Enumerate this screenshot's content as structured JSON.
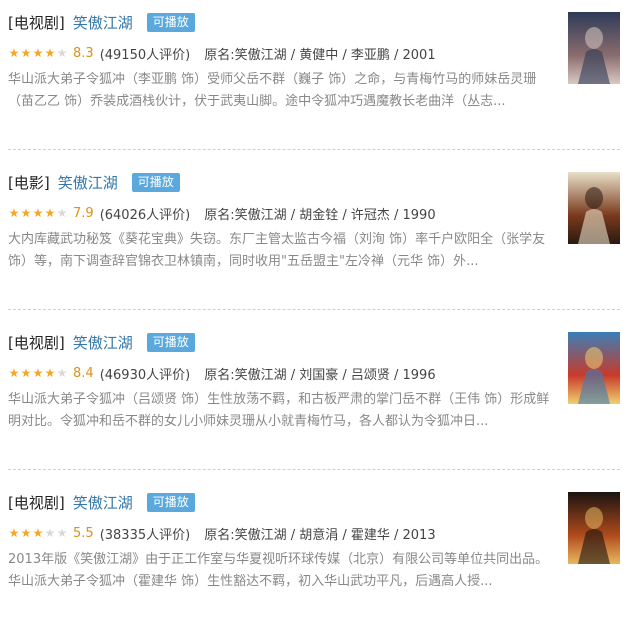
{
  "results": [
    {
      "category": "[电视剧]",
      "title": "笑傲江湖",
      "badge": "可播放",
      "rating_stars": 4,
      "score": "8.3",
      "votes": "(49150人评价)",
      "original": "原名:笑傲江湖 / 黄健中 / 李亚鹏 / 2001",
      "description": "华山派大弟子令狐冲（李亚鹏 饰）受师父岳不群（巍子 饰）之命，与青梅竹马的师妹岳灵珊（苗乙乙 饰）乔装成酒栈伙计，伏于武夷山脚。途中令狐冲巧遇魔教长老曲洋（丛志...",
      "poster_colors": [
        "#2d3b57",
        "#8a6c6e",
        "#d9c8c3"
      ]
    },
    {
      "category": "[电影]",
      "title": "笑傲江湖",
      "badge": "可播放",
      "rating_stars": 4,
      "score": "7.9",
      "votes": "(64026人评价)",
      "original": "原名:笑傲江湖 / 胡金铨 / 许冠杰 / 1990",
      "description": "大内库藏武功秘笈《葵花宝典》失窃。东厂主管太监古今福（刘洵 饰）率千户欧阳全（张学友 饰）等，南下调查辞官锦衣卫林镇南，同时收用\"五岳盟主\"左冷禅（元华 饰）外...",
      "poster_colors": [
        "#e8e0c8",
        "#7a3a1e",
        "#2a1a10"
      ]
    },
    {
      "category": "[电视剧]",
      "title": "笑傲江湖",
      "badge": "可播放",
      "rating_stars": 4,
      "score": "8.4",
      "votes": "(46930人评价)",
      "original": "原名:笑傲江湖 / 刘国豪 / 吕颂贤 / 1996",
      "description": "华山派大弟子令狐冲（吕颂贤 饰）生性放荡不羁，和古板严肃的掌门岳不群（王伟 饰）形成鲜明对比。令狐冲和岳不群的女儿小师妹灵珊从小就青梅竹马，各人都认为令狐冲日...",
      "poster_colors": [
        "#3a7fb8",
        "#c83a2a",
        "#f0d070"
      ]
    },
    {
      "category": "[电视剧]",
      "title": "笑傲江湖",
      "badge": "可播放",
      "rating_stars": 3,
      "score": "5.5",
      "votes": "(38335人评价)",
      "original": "原名:笑傲江湖 / 胡意涓 / 霍建华 / 2013",
      "description": "2013年版《笑傲江湖》由于正工作室与华夏视听环球传媒（北京）有限公司等单位共同出品。 华山派大弟子令狐冲（霍建华 饰）生性豁达不羁，初入华山武功平凡，后遇高人授...",
      "poster_colors": [
        "#1a1410",
        "#b04a1c",
        "#e8b860"
      ]
    }
  ]
}
